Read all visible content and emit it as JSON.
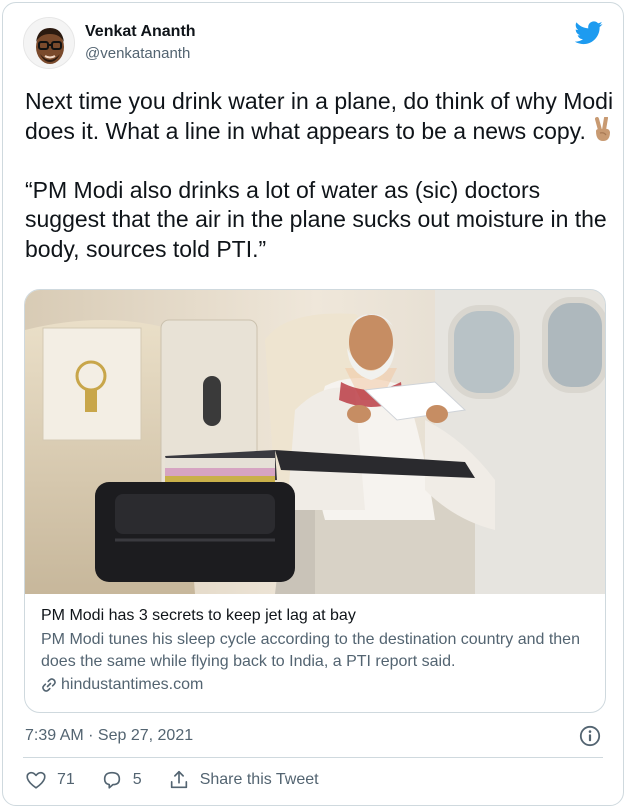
{
  "author": {
    "display_name": "Venkat Ananth",
    "handle": "@venkatananth"
  },
  "tweet": {
    "text_line1": "Next time you drink water in a plane, do think of why Modi does it. What a line in what appears to be a news copy.",
    "emoji": "✌🏽",
    "quote": "“PM Modi also drinks a lot of water as (sic) doctors suggest that the air in the plane sucks out moisture in the body, sources told PTI.”"
  },
  "card": {
    "title": "PM Modi has 3 secrets to keep jet lag at bay",
    "description": "PM Modi tunes his sleep cycle according to the destination country and then does the same while flying back to India, a PTI report said.",
    "domain": "hindustantimes.com",
    "image_icon": "photo-of-man-reading-papers-in-airplane-seat"
  },
  "meta": {
    "timestamp": "7:39 AM · Sep 27, 2021"
  },
  "actions": {
    "likes": "71",
    "replies": "5",
    "share_label": "Share this Tweet"
  },
  "colors": {
    "brand": "#1d9bf0",
    "text": "#0f1419",
    "secondary": "#536471",
    "border": "#cfd9de"
  }
}
